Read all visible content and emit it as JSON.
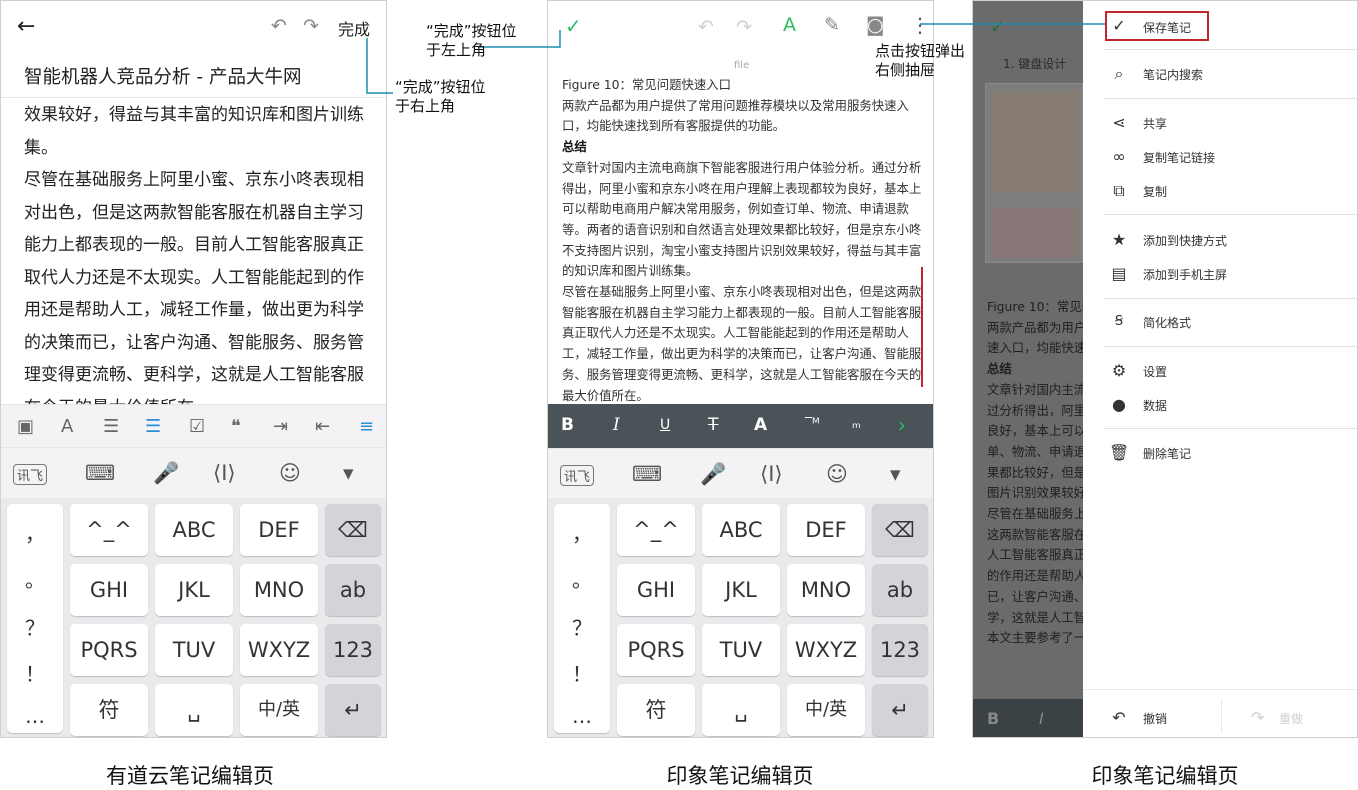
{
  "phone1": {
    "done_label": "完成",
    "title": "智能机器人竞品分析 - 产品大牛网",
    "paragraph1": "效果较好，得益与其丰富的知识库和图片训练集。",
    "paragraph2": "尽管在基础服务上阿里小蜜、京东小咚表现相对出色，但是这两款智能客服在机器自主学习能力上都表现的一般。目前人工智能客服真正取代人力还是不太现实。人工智能能起到的作用还是帮助人工，减轻工作量，做出更为科学的决策而已，让客户沟通、智能服务、服务管理变得更流畅、更科学，这就是人工智能客服在今天的最大价值所在。",
    "caption": "有道云笔记编辑页"
  },
  "phone2": {
    "file_label": "file",
    "fig_caption": "Figure 10：常见问题快速入口",
    "para1": "两款产品都为用户提供了常用问题推荐模块以及常用服务快速入口，均能快速找到所有客服提供的功能。",
    "heading": "总结",
    "para2": "文章针对国内主流电商旗下智能客服进行用户体验分析。通过分析得出，阿里小蜜和京东小咚在用户理解上表现都较为良好，基本上可以帮助电商用户解决常用服务，例如查订单、物流、申请退款等。两者的语音识别和自然语言处理效果都比较好，但是京东小咚不支持图片识别，淘宝小蜜支持图片识别效果较好，得益与其丰富的知识库和图片训练集。",
    "para3": "尽管在基础服务上阿里小蜜、京东小咚表现相对出色，但是这两款智能客服在机器自主学习能力上都表现的一般。目前人工智能客服真正取代人力还是不太现实。人工智能能起到的作用还是帮助人工，减轻工作量，做出更为科学的决策而已，让客户沟通、智能服务、服务管理变得更流畅、更科学，这就是人工智能客服在今天的最大价值所在。",
    "caption": "印象笔记编辑页"
  },
  "phone3": {
    "bg_heading": "1. 键盘设计",
    "bg_lines": [
      "Figure 10：常见问",
      "两款产品都为用户",
      "速入口，均能快速",
      "总结",
      "文章针对国内主流",
      "过分析得出，阿里",
      "良好，基本上可以",
      "单、物流、申请退",
      "果都比较好，但是",
      "图片识别效果较好",
      "尽管在基础服务上",
      "这两款智能客服在",
      "人工智能客服真正",
      "的作用还是帮助人",
      "已，让客户沟通、",
      "学，这就是人工智",
      "本文主要参考了一"
    ],
    "menu": [
      {
        "icon": "check-icon",
        "label": "保存笔记"
      },
      {
        "icon": "search-note-icon",
        "label": "笔记内搜索"
      },
      {
        "icon": "share-icon",
        "label": "共享"
      },
      {
        "icon": "link-icon",
        "label": "复制笔记链接"
      },
      {
        "icon": "copy-icon",
        "label": "复制"
      },
      {
        "icon": "star-icon",
        "label": "添加到快捷方式"
      },
      {
        "icon": "home-screen-icon",
        "label": "添加到手机主屏"
      },
      {
        "icon": "simplify-format-icon",
        "label": "简化格式"
      },
      {
        "icon": "settings-icon",
        "label": "设置"
      },
      {
        "icon": "info-icon",
        "label": "数据"
      },
      {
        "icon": "trash-icon",
        "label": "删除笔记"
      }
    ],
    "undo_label": "撤销",
    "redo_label": "重做",
    "caption": "印象笔记编辑页"
  },
  "annotations": {
    "done_right": "“完成”按钮位于右上角",
    "done_left": "“完成”按钮位于左上角",
    "menu_drawer": "点击按钮弹出右侧抽屉"
  },
  "keyboard": {
    "brand": "讯飞",
    "side_keys": [
      "，",
      "。",
      "？",
      "！",
      "…"
    ],
    "rows": [
      [
        "^_^",
        "ABC",
        "DEF"
      ],
      [
        "GHI",
        "JKL",
        "MNO"
      ],
      [
        "PQRS",
        "TUV",
        "WXYZ"
      ]
    ],
    "ab_key": "ab",
    "num_key": "123",
    "sym_key": "符",
    "lang_key": "中/英"
  },
  "colors": {
    "green": "#2dbe60",
    "highlight_red": "#c0272d",
    "annotation_line": "#1a8fb0",
    "format_bar": "#4a5458",
    "accent_blue": "#2b8fd6"
  }
}
